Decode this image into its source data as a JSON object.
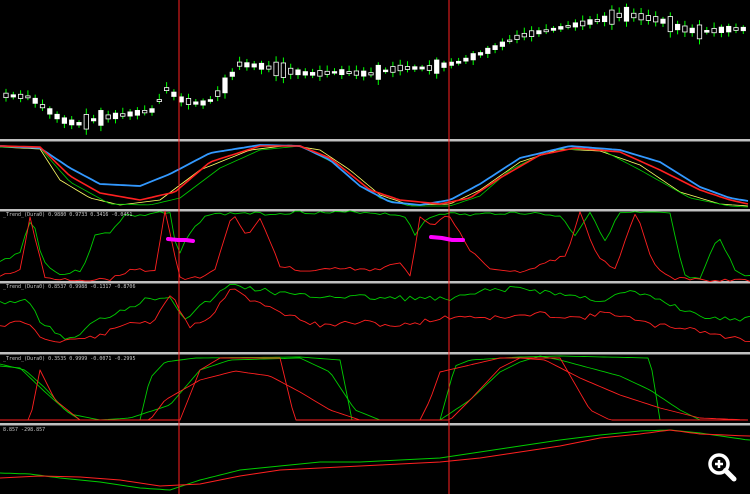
{
  "colors": {
    "background": "#000000",
    "separator": "#c0c0c0",
    "candle_up": "#000000",
    "candle_down": "#ffffff",
    "candle_outline": "#ffffff",
    "wick": "#00ff00",
    "vertical_marker": "#ff2020",
    "line_green": "#00cc00",
    "line_red": "#ff2020",
    "line_blue": "#3399ff",
    "line_yellow": "#ffff66",
    "highlight_magenta": "#ff00ff"
  },
  "icons": {
    "zoom": "zoom-in-magnifier-icon"
  },
  "panels": [
    {
      "name": "price-panel",
      "label": ""
    },
    {
      "name": "oscillator-panel",
      "label": ""
    },
    {
      "name": "trend-duration-panel-1",
      "label": "_Trend_(Dura0) 0.9880 0.9733 0.3416 -0.0451"
    },
    {
      "name": "trend-duration-panel-2",
      "label": "_Trend_(Dura0) 0.8537 0.9988 -0.1317 -0.8706"
    },
    {
      "name": "trend-duration-panel-3",
      "label": "_Trend_(Dura0) 0.3535 0.9999 -0.0071 -0.2995"
    },
    {
      "name": "cumulative-panel",
      "label": "8.857 -298.857"
    }
  ]
}
